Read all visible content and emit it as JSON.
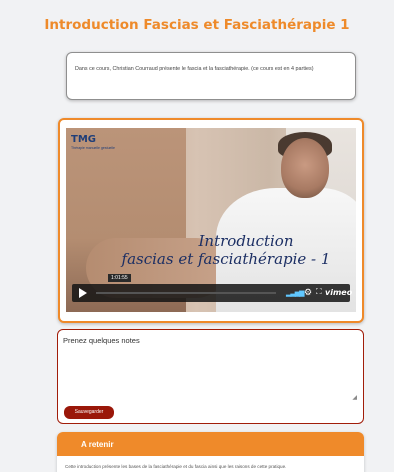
{
  "page": {
    "title": "Introduction Fascias et Fasciathérapie 1"
  },
  "description": {
    "text": "Dans ce cours, Christian Courraud présente le fascia et la fasciathérapie. (ce cours est en 4 parties)"
  },
  "video": {
    "logo": "TMG",
    "logo_sub": "Thérapie manuelle gestuelle",
    "title_line1": "Introduction",
    "title_line2": "fascias et fasciathérapie - 1",
    "timestamp": "1:01:55",
    "progress_percent": 0,
    "player_brand": "vimeo",
    "icons": {
      "play": "play-icon",
      "volume": "volume-icon",
      "settings": "gear-icon",
      "fullscreen": "fullscreen-icon"
    }
  },
  "notes": {
    "label": "Prenez quelques notes",
    "value": "",
    "save_label": "Sauvegarder"
  },
  "retain": {
    "header": "A retenir",
    "text": "Cette introduction présente les bases de la fasciathérapie et du fascia ainsi que les raisons de cette pratique."
  },
  "colors": {
    "accent": "#ef8a2a",
    "dark_red": "#9a1709",
    "background": "#f1f2f4"
  }
}
